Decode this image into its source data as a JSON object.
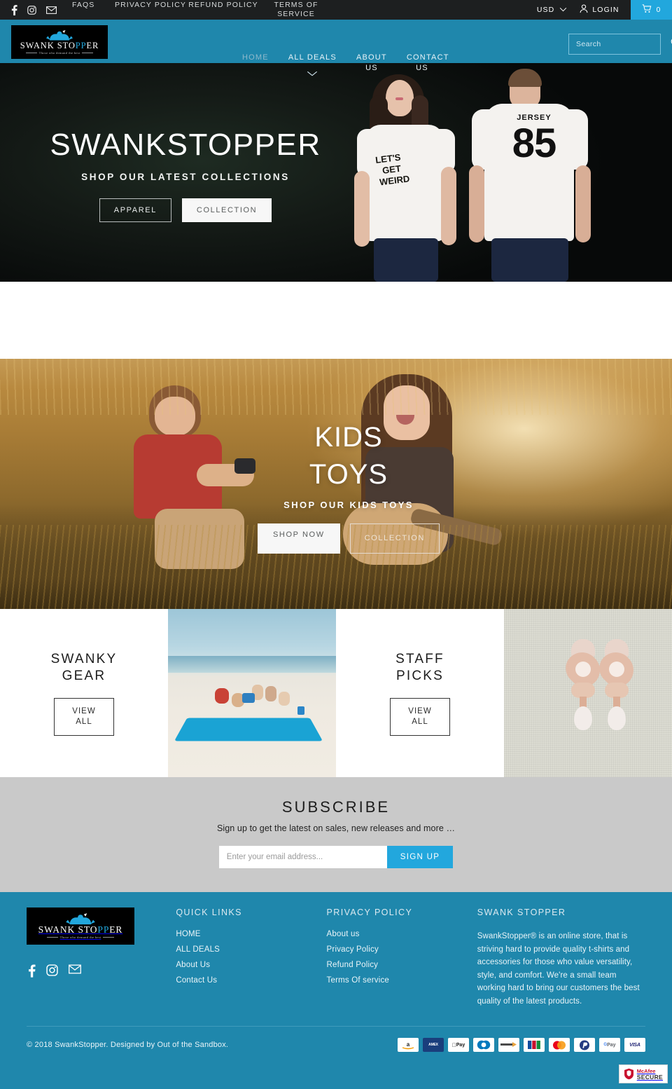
{
  "topbar": {
    "social": [
      {
        "name": "facebook-icon",
        "label": "Facebook"
      },
      {
        "name": "instagram-icon",
        "label": "Instagram"
      },
      {
        "name": "email-icon",
        "label": "Email"
      }
    ],
    "links": [
      {
        "label": "FAQS"
      },
      {
        "label": "PRIVACY POLICY"
      },
      {
        "label": "REFUND POLICY"
      },
      {
        "label": "TERMS OF SERVICE"
      }
    ],
    "currency": "USD",
    "login": "LOGIN",
    "cart_count": "0"
  },
  "header": {
    "logo": {
      "word_a": "SWANK STO",
      "word_b": "PP",
      "word_c": "ER",
      "tagline": "Those who demand the best"
    },
    "nav": [
      {
        "label": "HOME",
        "dim": true,
        "caret": false
      },
      {
        "label": "ALL DEALS",
        "dim": false,
        "caret": true
      },
      {
        "label": "ABOUT US",
        "dim": false,
        "caret": false
      },
      {
        "label": "CONTACT US",
        "dim": false,
        "caret": false
      }
    ],
    "search_placeholder": "Search",
    "search_value": ""
  },
  "hero": {
    "title": "SWANKSTOPPER",
    "subtitle": "SHOP OUR LATEST COLLECTIONS",
    "btn_primary": "APPAREL",
    "btn_secondary": "COLLECTION",
    "shirt_left_text": "LET'S GET WEIRD",
    "shirt_right_top": "JERSEY",
    "shirt_right_number": "85"
  },
  "kids": {
    "title_line1": "KIDS",
    "title_line2": "TOYS",
    "subtitle": "SHOP OUR KIDS TOYS",
    "btn_primary": "SHOP NOW",
    "btn_secondary": "COLLECTION"
  },
  "tiles": [
    {
      "type": "text",
      "title_line1": "SWANKY",
      "title_line2": "GEAR",
      "button_line1": "VIEW",
      "button_line2": "ALL",
      "name": "swanky-gear"
    },
    {
      "type": "image",
      "name": "beach-lifestyle-image"
    },
    {
      "type": "text",
      "title_line1": "STAFF",
      "title_line2": "PICKS",
      "button_line1": "VIEW",
      "button_line2": "ALL",
      "name": "staff-picks"
    },
    {
      "type": "image",
      "name": "earrings-product-image"
    }
  ],
  "subscribe": {
    "title": "SUBSCRIBE",
    "text": "Sign up to get the latest on sales, new releases and more …",
    "placeholder": "Enter your email address...",
    "value": "",
    "button": "SIGN UP"
  },
  "footer": {
    "quick_links": {
      "heading": "QUICK LINKS",
      "items": [
        "HOME",
        "ALL DEALS",
        "About Us",
        "Contact Us"
      ]
    },
    "privacy": {
      "heading": "PRIVACY POLICY",
      "items": [
        "About us",
        "Privacy Policy",
        "Refund Policy",
        "Terms Of service"
      ]
    },
    "about": {
      "heading": "SWANK STOPPER",
      "body": "SwankStopper® is an online store, that is striving hard to provide quality t-shirts and accessories for those who value versatility, style, and comfort. We're a small team working hard to bring our customers the best quality of the latest products."
    },
    "social": [
      {
        "name": "facebook-icon"
      },
      {
        "name": "instagram-icon"
      },
      {
        "name": "email-icon"
      }
    ],
    "copyright": "© 2018 SwankStopper. Designed by Out of the Sandbox.",
    "payments": [
      {
        "name": "amazon-pay-icon",
        "label": "amazon"
      },
      {
        "name": "american-express-icon",
        "label": "AMEX"
      },
      {
        "name": "apple-pay-icon",
        "label": "Pay"
      },
      {
        "name": "diners-club-icon",
        "label": "Diners"
      },
      {
        "name": "discover-icon",
        "label": "DISCOVER"
      },
      {
        "name": "jcb-icon",
        "label": "JCB"
      },
      {
        "name": "mastercard-icon",
        "label": "MC"
      },
      {
        "name": "paypal-icon",
        "label": "PayPal"
      },
      {
        "name": "google-pay-icon",
        "label": "Pay"
      },
      {
        "name": "visa-icon",
        "label": "VISA"
      }
    ],
    "mcafee": {
      "line1": "McAfee",
      "line2": "SECURE"
    }
  },
  "colors": {
    "brand_teal": "#1f87ac",
    "accent_blue": "#22a7dd",
    "topbar_dark": "#1d1f20",
    "subscribe_gray": "#c9c9c9"
  }
}
